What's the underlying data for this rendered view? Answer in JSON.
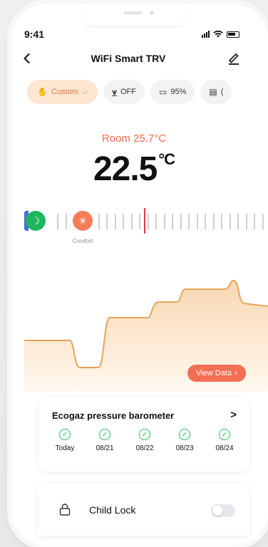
{
  "status_bar": {
    "time": "9:41"
  },
  "header": {
    "title": "WiFi Smart TRV"
  },
  "mode_chips": [
    {
      "label": "Custom",
      "icon": "hand-icon",
      "chevron": "⌵"
    },
    {
      "label": "OFF",
      "icon": "window-icon"
    },
    {
      "label": "95%",
      "icon": "battery-icon"
    },
    {
      "label": "(",
      "icon": "calendar-icon"
    }
  ],
  "thermostat": {
    "room_label": "Room 25.7°C",
    "set_temp": "22.5",
    "unit": "°C",
    "preset_label": "Comfort"
  },
  "chart_button": {
    "label": "View Data",
    "chevron": "›"
  },
  "barometer": {
    "title": "Ecogaz pressure barometer",
    "chevron": ">",
    "days": [
      {
        "label": "Today"
      },
      {
        "label": "08/21"
      },
      {
        "label": "08/22"
      },
      {
        "label": "08/23"
      },
      {
        "label": "08/24"
      }
    ]
  },
  "child_lock": {
    "label": "Child Lock",
    "enabled": false
  },
  "colors": {
    "accent": "#f26e55",
    "chip_custom_bg": "#fde6d2",
    "eco_green": "#1eb65e",
    "comfort_orange": "#f57b57",
    "check_green": "#2eb85c"
  }
}
